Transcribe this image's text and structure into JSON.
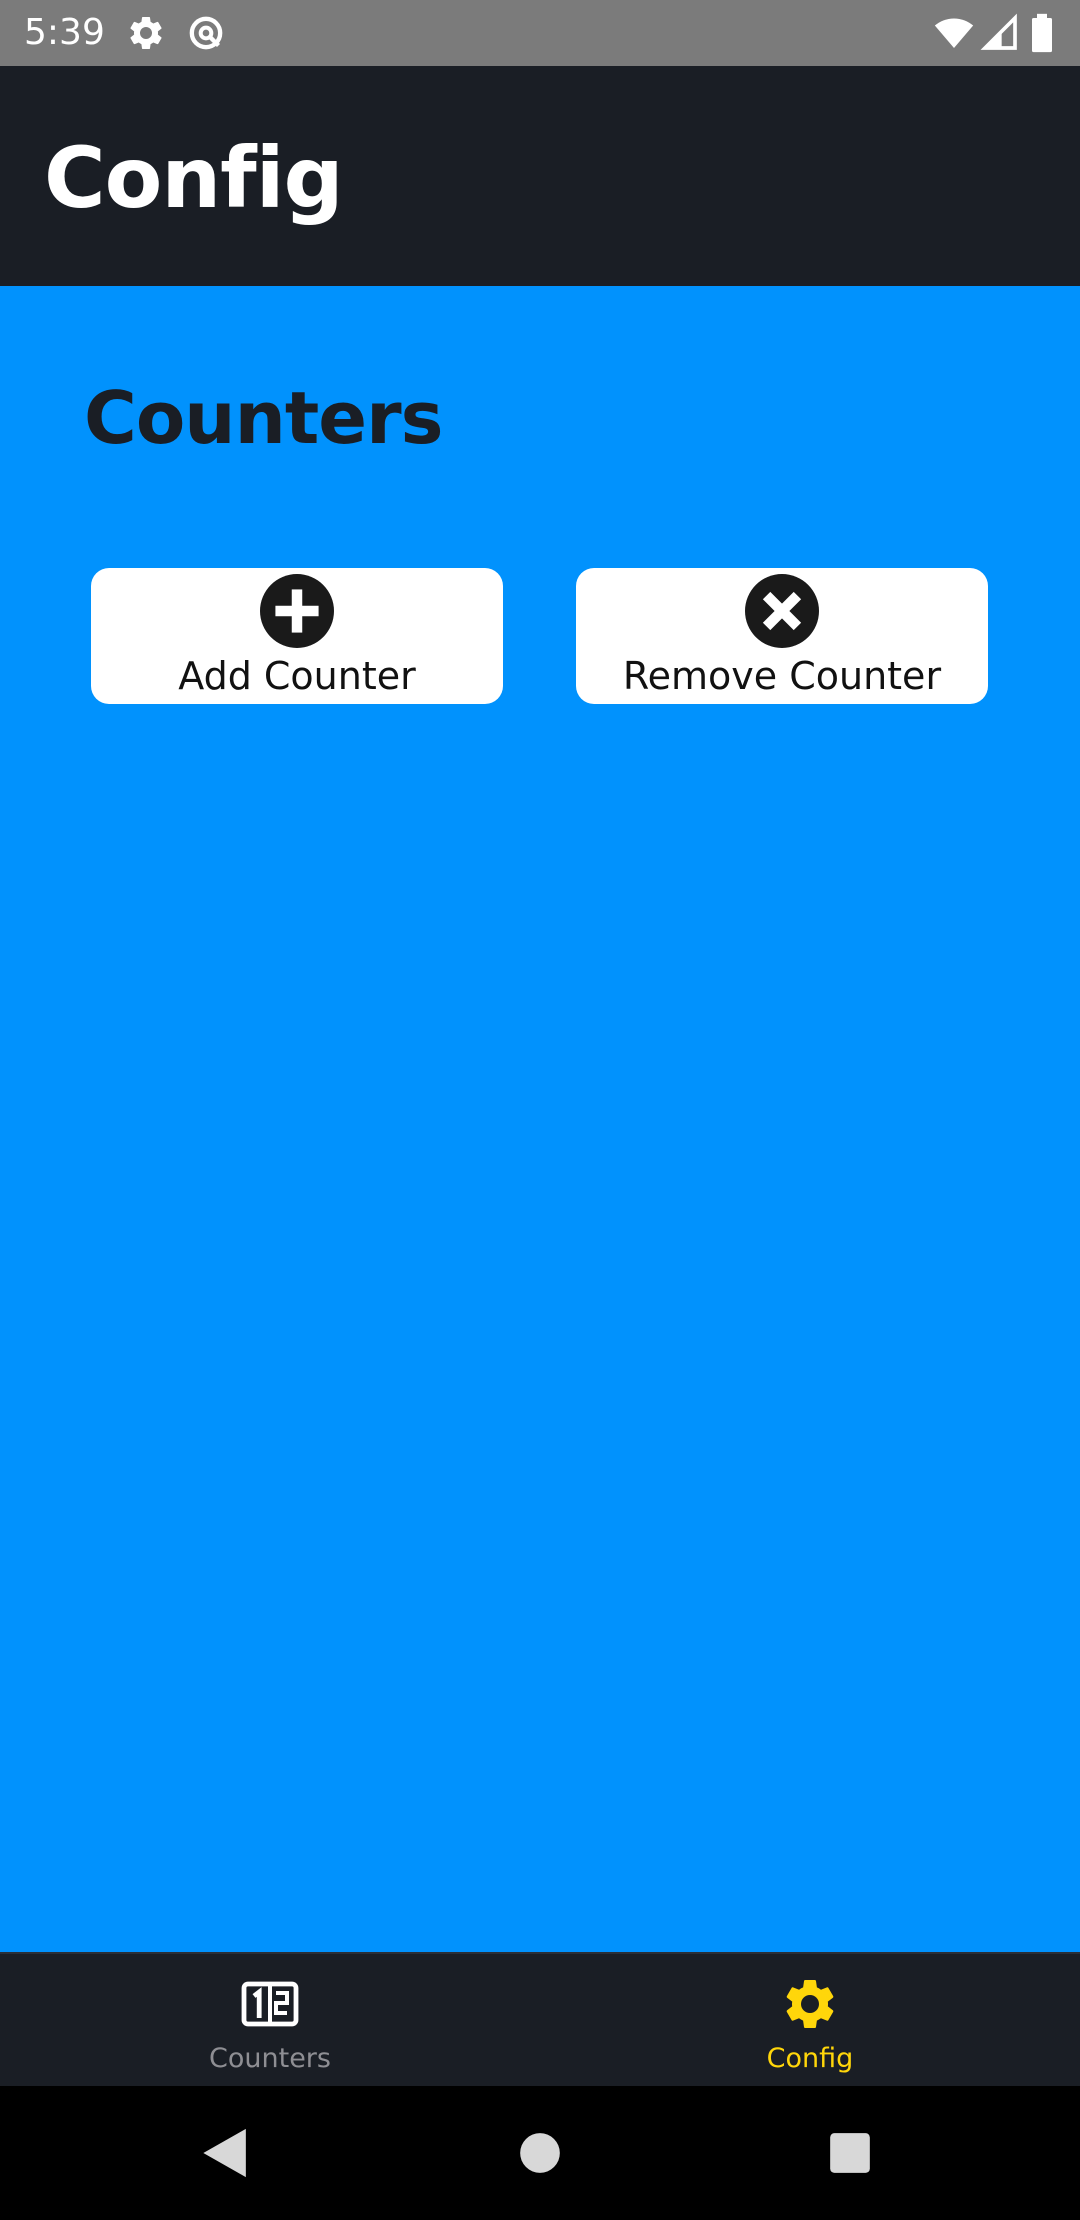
{
  "status_bar": {
    "time": "5:39",
    "icons": [
      "settings-icon",
      "vpn-key-icon",
      "wifi-icon",
      "signal-icon",
      "battery-icon"
    ]
  },
  "app_bar": {
    "title": "Config"
  },
  "content": {
    "section_title": "Counters",
    "buttons": [
      {
        "label": "Add Counter",
        "icon": "plus-circle-icon"
      },
      {
        "label": "Remove Counter",
        "icon": "close-circle-icon"
      }
    ]
  },
  "tabs": [
    {
      "label": "Counters",
      "icon": "counter-icon",
      "active": false
    },
    {
      "label": "Config",
      "icon": "gear-icon",
      "active": true
    }
  ],
  "colors": {
    "status_bar_bg": "#7b7b7b",
    "app_bar_bg": "#1a1e25",
    "content_bg": "#0192fd",
    "button_bg": "#ffffff",
    "tab_bar_bg": "#1a1e25",
    "tab_active": "#ffd60a",
    "tab_inactive": "#8e8e93",
    "nav_bar_bg": "#000000"
  },
  "nav_bar": {
    "buttons": [
      "back-icon",
      "home-icon",
      "recents-icon"
    ]
  }
}
